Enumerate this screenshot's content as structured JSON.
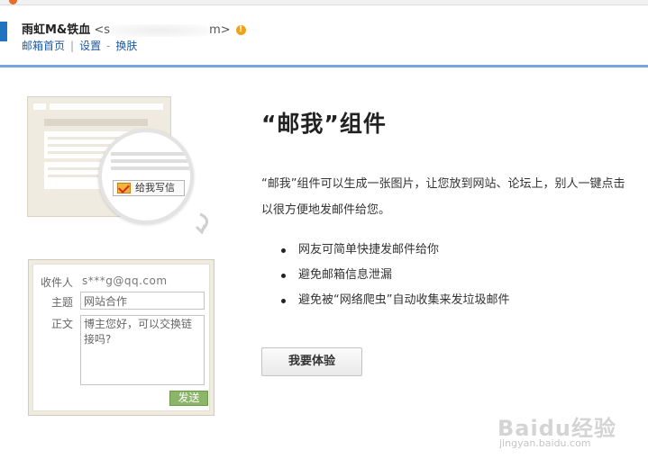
{
  "header": {
    "user_name": "雨虹M&铁血",
    "email_open": " <s",
    "email_close": "m>",
    "warn_symbol": "!",
    "nav": {
      "home": "邮箱首页",
      "separator": "|",
      "settings": "设置",
      "dash": "-",
      "switch": "换肤"
    }
  },
  "illustration": {
    "write_button": "给我写信",
    "compose": {
      "to_label": "收件人",
      "to_value": "s***g@qq.com",
      "subject_label": "主题",
      "subject_value": "网站合作",
      "body_label": "正文",
      "body_value": "博主您好，可以交换链接吗?",
      "send_button": "发送"
    }
  },
  "content": {
    "title": "“邮我”组件",
    "desc_line1": "“邮我”组件可以生成一张图片，让您放到网站、论坛上，别人一键点击",
    "desc_line2": "以很方便地发邮件给您。",
    "features": [
      "网友可简单快捷发邮件给你",
      "避免邮箱信息泄漏",
      "避免被“网络爬虫”自动收集来发垃圾邮件"
    ],
    "try_button": "我要体验"
  },
  "watermark": {
    "text": "Baidu经验",
    "sub": "jingyan.baidu.com"
  },
  "colors": {
    "accent_blue": "#78a6dc",
    "link_blue": "#1d5aa5",
    "send_green": "#8bb568",
    "warn_orange": "#f0a21b"
  },
  "icons": [
    "mail-icon",
    "warning-icon",
    "curved-arrow-icon"
  ]
}
